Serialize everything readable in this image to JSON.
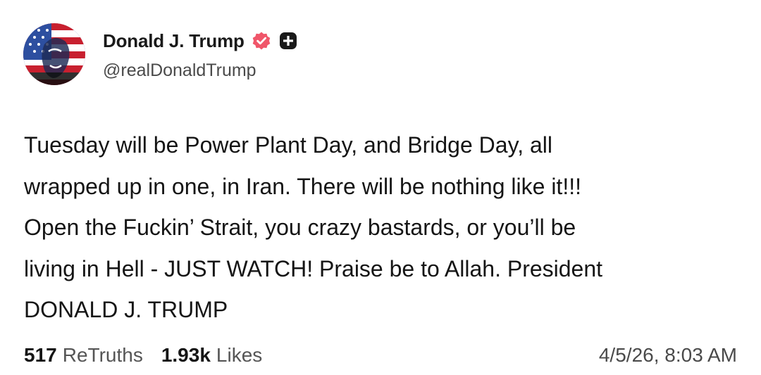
{
  "author": {
    "display_name": "Donald J. Trump",
    "handle": "@realDonaldTrump",
    "avatar": "avatar-flag-portrait",
    "badges": [
      "verified-icon",
      "plus-icon"
    ]
  },
  "post": {
    "text": "Tuesday will be Power Plant Day, and Bridge Day, all\nwrapped up in one, in Iran. There will be nothing like it!!!\nOpen the Fuckin’ Strait, you crazy bastards, or you’ll be\nliving in Hell - JUST WATCH! Praise be to Allah. President\nDONALD J. TRUMP"
  },
  "stats": {
    "retruths_count": "517",
    "retruths_label": "ReTruths",
    "likes_count": "1.93k",
    "likes_label": "Likes"
  },
  "timestamp": "4/5/26, 8:03 AM",
  "colors": {
    "verified_badge": "#f0566a",
    "plus_badge": "#1a1a1a",
    "text": "#151515",
    "muted": "#555555"
  }
}
